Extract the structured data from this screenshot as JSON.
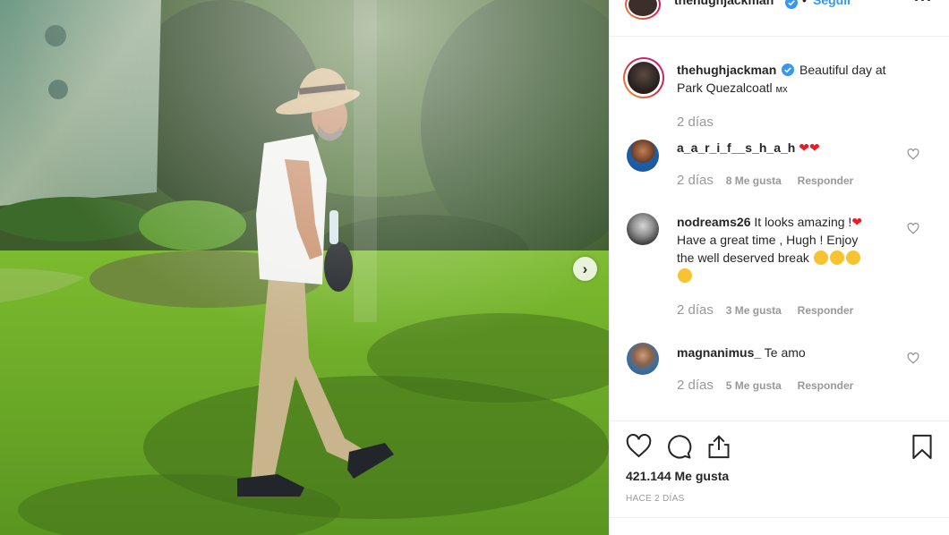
{
  "header": {
    "username": "thehughjackman",
    "separator": "•",
    "follow_label": "Seguir",
    "more_label": "···"
  },
  "caption": {
    "username": "thehughjackman",
    "text": "Beautiful day at Park Quezalcoatl",
    "flag": "ᴍx",
    "time": "2 días"
  },
  "comments": [
    {
      "username": "a_a_r_i_f__s_h_a_h",
      "display_username": "a_a_r_i_f__s_h_a_h",
      "text": "",
      "time": "2 días",
      "likes": "8 Me gusta",
      "reply": "Responder"
    },
    {
      "username": "nodreams26",
      "text_line1": "It looks amazing !",
      "text_line2": "Have a great time , Hugh ! Enjoy",
      "text_line3": "the well deserved break",
      "time": "2 días",
      "likes": "3 Me gusta",
      "reply": "Responder"
    },
    {
      "username": "magnanimus_",
      "text": "Te amo",
      "time": "2 días",
      "likes": "5 Me gusta",
      "reply": "Responder"
    }
  ],
  "actions": {
    "likes_count": "421.144 Me gusta",
    "post_time": "HACE 2 DÍAS"
  },
  "icons": [
    "heart-icon",
    "comment-icon",
    "share-icon",
    "bookmark-icon",
    "verified-icon",
    "chevron-right-icon",
    "more-icon"
  ],
  "colors": {
    "accent": "#3897f0",
    "text": "#262626",
    "muted": "#999999",
    "heart": "#ed1c24"
  }
}
